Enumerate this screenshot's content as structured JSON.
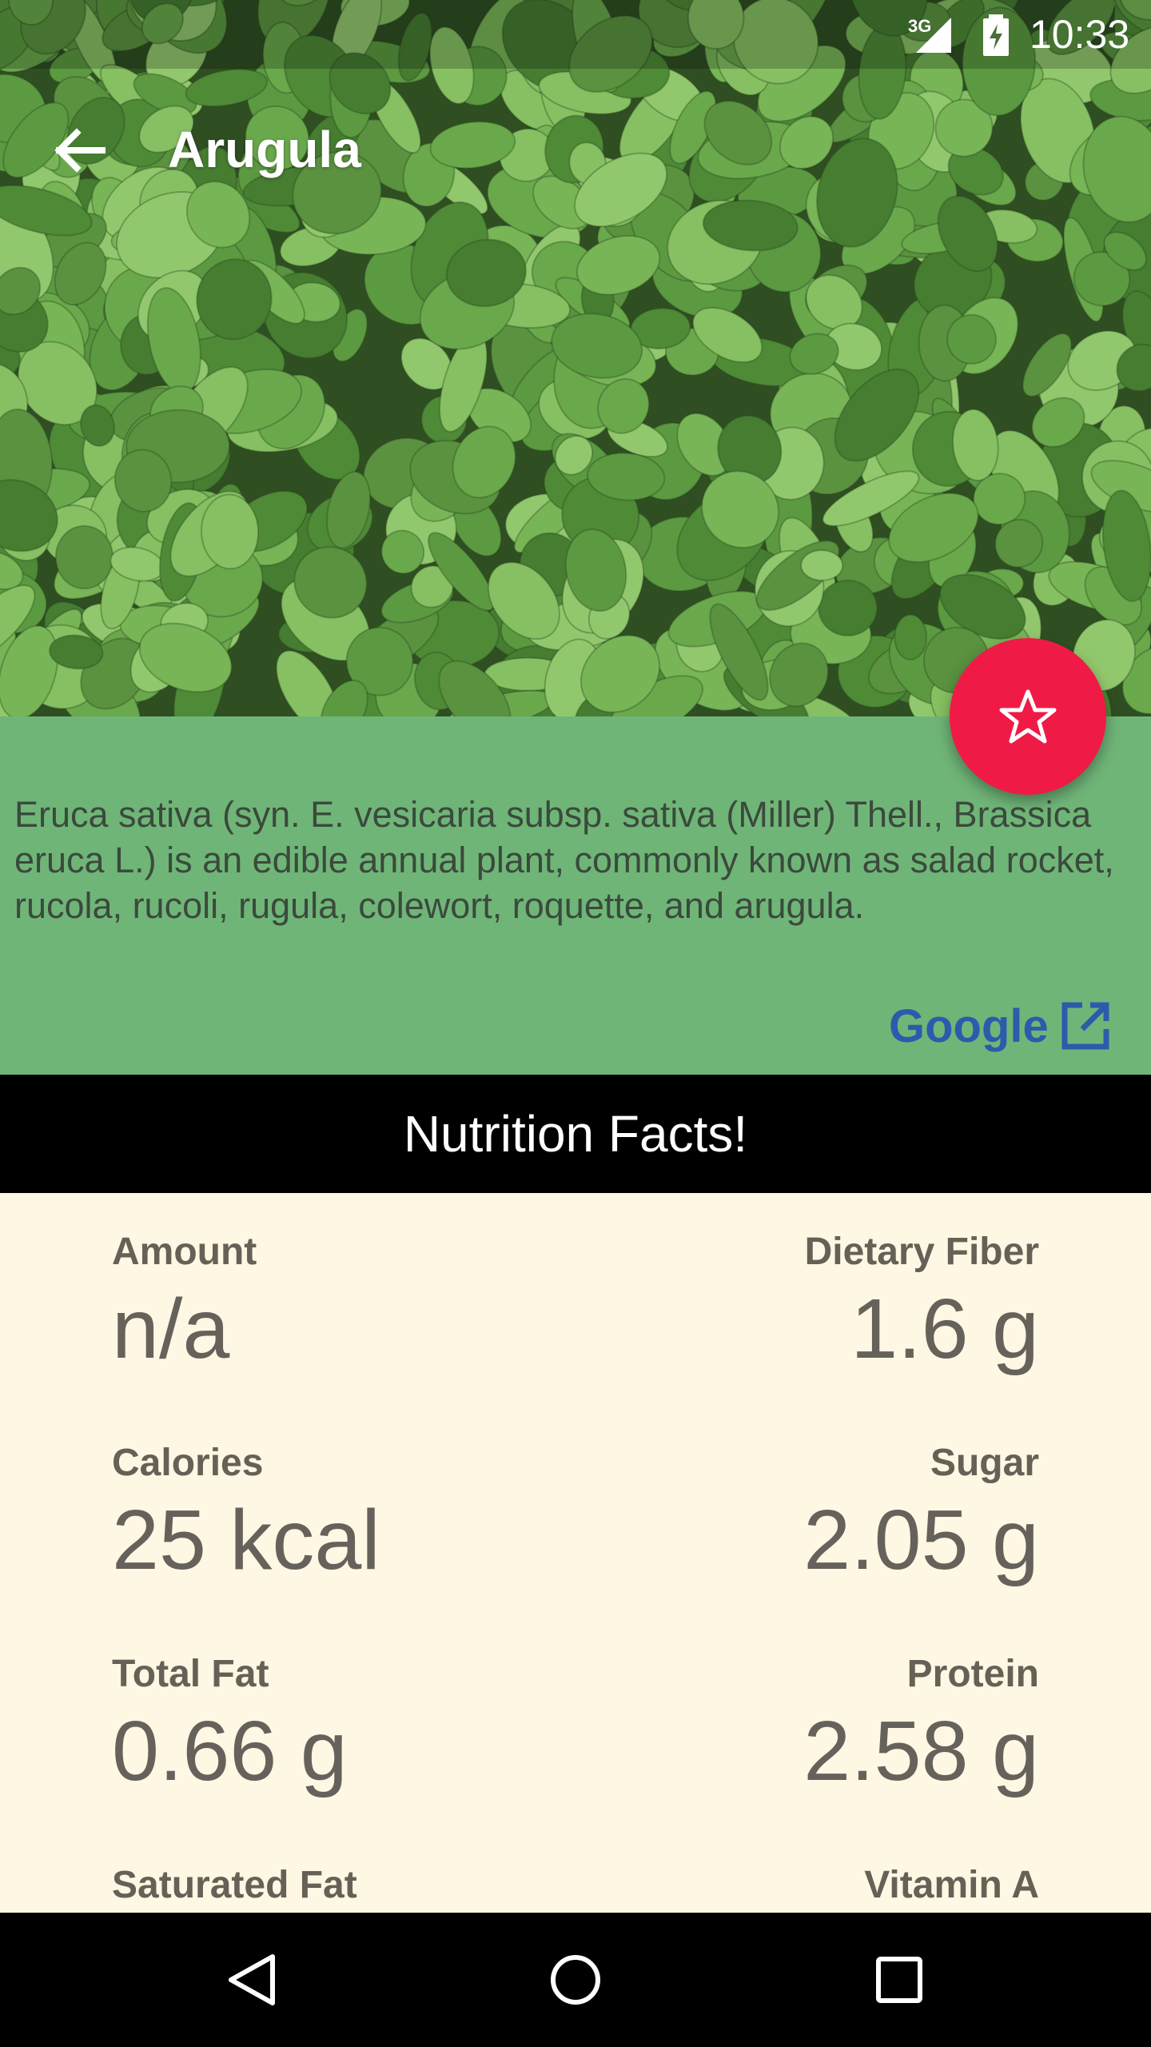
{
  "status_bar": {
    "network": "3G",
    "time": "10:33"
  },
  "toolbar": {
    "title": "Arugula",
    "back_icon": "arrow-back-icon"
  },
  "description": {
    "text": "Eruca sativa (syn. E. vesicaria subsp. sativa (Miller) Thell., Brassica eruca L.) is an edible annual plant, commonly known as salad rocket, rucola, rucoli, rugula, colewort, roquette, and arugula.",
    "link_label": "Google",
    "link_icon": "open-in-new-icon"
  },
  "fab": {
    "icon": "star-outline-icon",
    "color": "#f01a47"
  },
  "nutrition": {
    "header": "Nutrition Facts!",
    "items": [
      {
        "label": "Amount",
        "value": "n/a"
      },
      {
        "label": "Dietary Fiber",
        "value": "1.6 g"
      },
      {
        "label": "Calories",
        "value": "25 kcal"
      },
      {
        "label": "Sugar",
        "value": "2.05 g"
      },
      {
        "label": "Total Fat",
        "value": "0.66 g"
      },
      {
        "label": "Protein",
        "value": "2.58 g"
      },
      {
        "label": "Saturated Fat",
        "value": ""
      },
      {
        "label": "Vitamin A",
        "value": ""
      }
    ]
  },
  "nav_bar": {
    "back_icon": "nav-back-icon",
    "home_icon": "nav-home-icon",
    "recents_icon": "nav-recents-icon"
  },
  "colors": {
    "description_bg": "#70b578",
    "link": "#2d5bab",
    "nutrition_bg": "#fdf7e3"
  }
}
